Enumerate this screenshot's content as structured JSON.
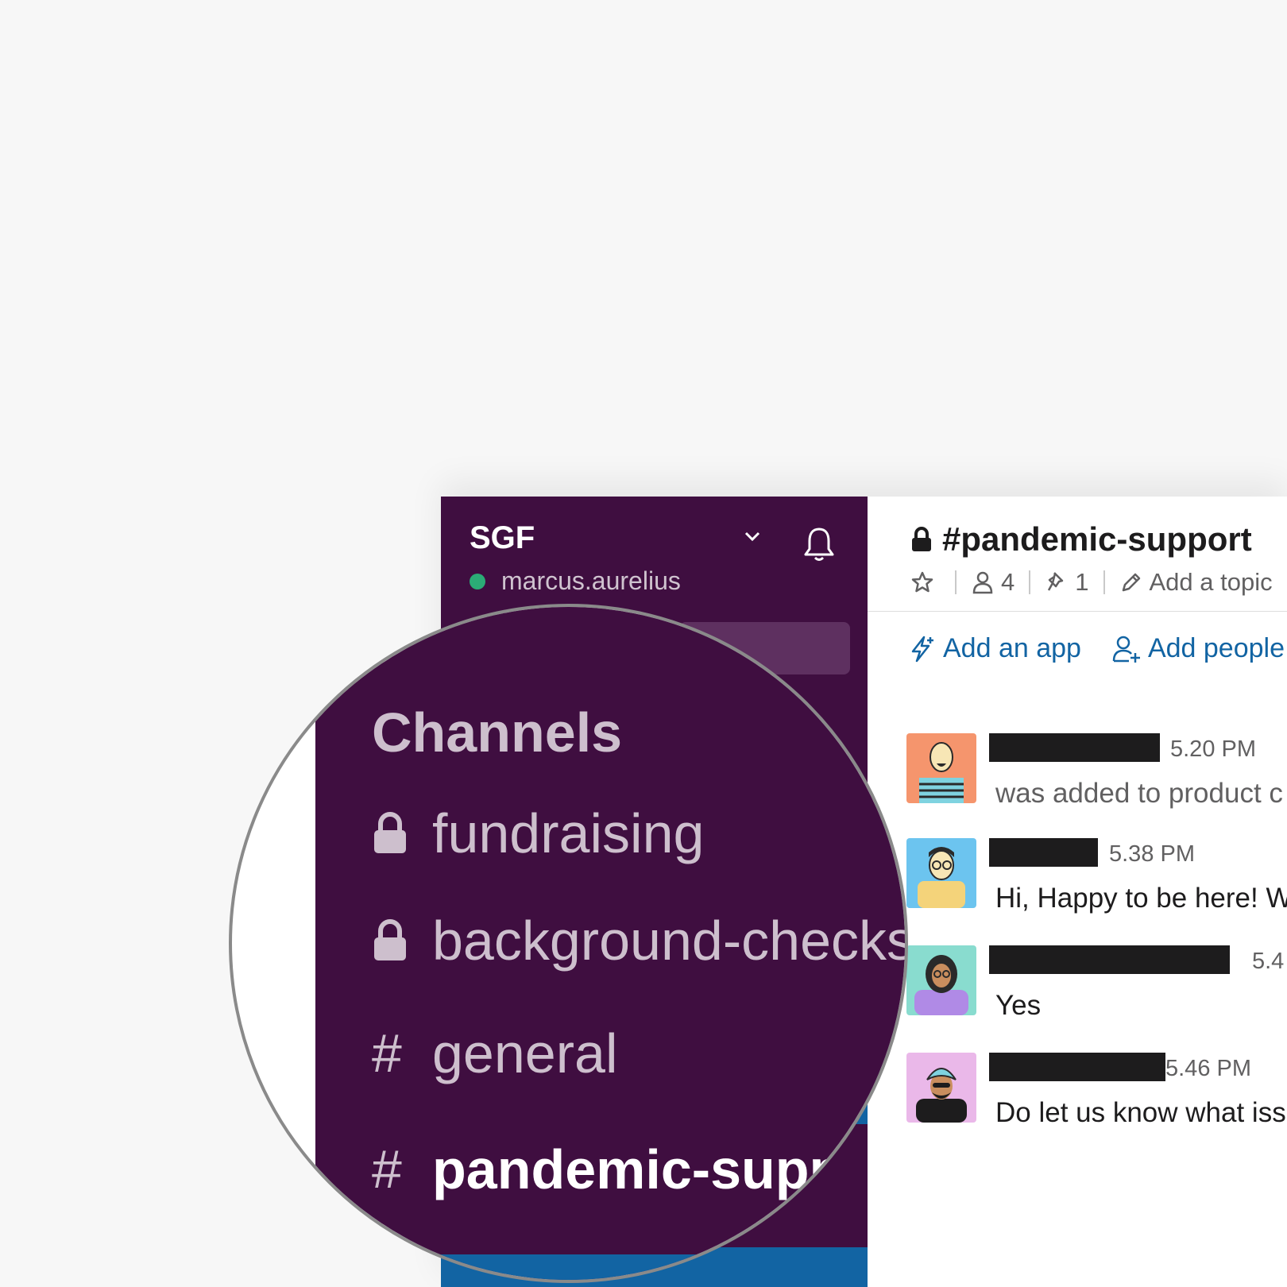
{
  "sidebar": {
    "team_name": "SGF",
    "user_name": "marcus.aurelius",
    "presence_color": "#2bac76",
    "background_color": "#3f0e40"
  },
  "channel": {
    "title": "#pandemic-support",
    "members_count": "4",
    "pins_count": "1",
    "topic_placeholder": "Add a topic",
    "add_app_label": "Add an app",
    "add_people_label": "Add people"
  },
  "messages": [
    {
      "time": "5.20 PM",
      "text": "was added to product c",
      "avatar": "bald-man-avatar"
    },
    {
      "time": "5.38 PM",
      "text": "Hi, Happy to be here! W",
      "avatar": "glasses-man-avatar"
    },
    {
      "time": "5.4",
      "text": "Yes",
      "avatar": "hijab-woman-avatar"
    },
    {
      "time": "5.46 PM",
      "text": "Do let us know what iss",
      "avatar": "turban-man-avatar"
    }
  ],
  "magnifier": {
    "heading": "Channels",
    "items": [
      {
        "icon": "lock-icon",
        "label": "fundraising"
      },
      {
        "icon": "lock-icon",
        "label": "background-checks"
      },
      {
        "icon": "hash-icon",
        "prefix": "#",
        "label": "general"
      },
      {
        "icon": "hash-icon",
        "prefix": "#",
        "label": "pandemic-supp"
      }
    ]
  },
  "colors": {
    "accent_link": "#1264a3",
    "sidebar": "#3f0e40",
    "active_channel": "#1264a3"
  }
}
